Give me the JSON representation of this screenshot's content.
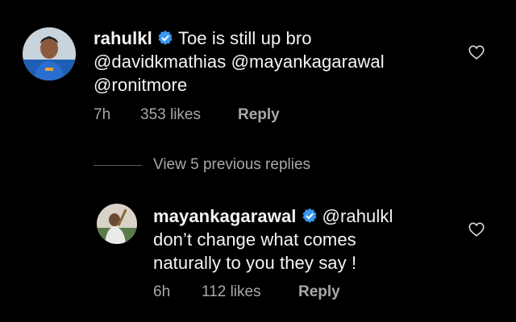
{
  "comment": {
    "username": "rahulkl",
    "text_line1": "Toe is still up bro",
    "text_line2": "@davidkmathias @mayankagarawal",
    "text_line3": "@ronitmore",
    "time": "7h",
    "likes": "353 likes",
    "reply_label": "Reply",
    "verified_icon": "verified-badge-icon",
    "like_icon": "heart-outline-icon"
  },
  "view_replies": {
    "label": "View 5 previous replies"
  },
  "reply": {
    "username": "mayankagarawal",
    "text_line1": "@rahulkl",
    "text_line2": "don’t change what comes",
    "text_line3": "naturally to you they say !",
    "time": "6h",
    "likes": "112 likes",
    "reply_label": "Reply",
    "verified_icon": "verified-badge-icon",
    "like_icon": "heart-outline-icon"
  },
  "colors": {
    "background": "#000000",
    "text": "#f5f5f5",
    "secondary_text": "#a8a8a8",
    "verified_blue": "#3897f0"
  }
}
